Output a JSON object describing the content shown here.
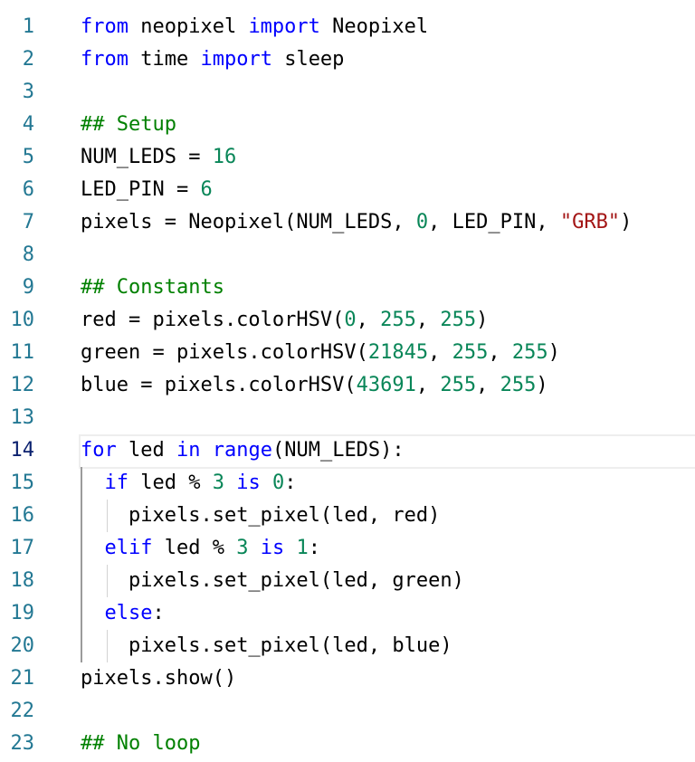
{
  "editor": {
    "active_line": 14,
    "colors": {
      "line_number": "#237893",
      "active_line_number": "#0b216f",
      "keyword": "#0000ff",
      "number": "#098658",
      "string": "#a31515",
      "comment": "#008000",
      "text": "#000000"
    },
    "lines": [
      {
        "n": "1",
        "indent": 0,
        "tokens": [
          [
            "kw",
            "from"
          ],
          [
            "t",
            " neopixel "
          ],
          [
            "kw",
            "import"
          ],
          [
            "t",
            " Neopixel"
          ]
        ]
      },
      {
        "n": "2",
        "indent": 0,
        "tokens": [
          [
            "kw",
            "from"
          ],
          [
            "t",
            " time "
          ],
          [
            "kw",
            "import"
          ],
          [
            "t",
            " sleep"
          ]
        ]
      },
      {
        "n": "3",
        "indent": 0,
        "tokens": []
      },
      {
        "n": "4",
        "indent": 0,
        "tokens": [
          [
            "com",
            "## Setup"
          ]
        ]
      },
      {
        "n": "5",
        "indent": 0,
        "tokens": [
          [
            "t",
            "NUM_LEDS = "
          ],
          [
            "num",
            "16"
          ]
        ]
      },
      {
        "n": "6",
        "indent": 0,
        "tokens": [
          [
            "t",
            "LED_PIN = "
          ],
          [
            "num",
            "6"
          ]
        ]
      },
      {
        "n": "7",
        "indent": 0,
        "tokens": [
          [
            "t",
            "pixels = Neopixel(NUM_LEDS, "
          ],
          [
            "num",
            "0"
          ],
          [
            "t",
            ", LED_PIN, "
          ],
          [
            "str",
            "\"GRB\""
          ],
          [
            "t",
            ")"
          ]
        ]
      },
      {
        "n": "8",
        "indent": 0,
        "tokens": []
      },
      {
        "n": "9",
        "indent": 0,
        "tokens": [
          [
            "com",
            "## Constants"
          ]
        ]
      },
      {
        "n": "10",
        "indent": 0,
        "tokens": [
          [
            "t",
            "red = pixels.colorHSV("
          ],
          [
            "num",
            "0"
          ],
          [
            "t",
            ", "
          ],
          [
            "num",
            "255"
          ],
          [
            "t",
            ", "
          ],
          [
            "num",
            "255"
          ],
          [
            "t",
            ")"
          ]
        ]
      },
      {
        "n": "11",
        "indent": 0,
        "tokens": [
          [
            "t",
            "green = pixels.colorHSV("
          ],
          [
            "num",
            "21845"
          ],
          [
            "t",
            ", "
          ],
          [
            "num",
            "255"
          ],
          [
            "t",
            ", "
          ],
          [
            "num",
            "255"
          ],
          [
            "t",
            ")"
          ]
        ]
      },
      {
        "n": "12",
        "indent": 0,
        "tokens": [
          [
            "t",
            "blue = pixels.colorHSV("
          ],
          [
            "num",
            "43691"
          ],
          [
            "t",
            ", "
          ],
          [
            "num",
            "255"
          ],
          [
            "t",
            ", "
          ],
          [
            "num",
            "255"
          ],
          [
            "t",
            ")"
          ]
        ]
      },
      {
        "n": "13",
        "indent": 0,
        "tokens": []
      },
      {
        "n": "14",
        "indent": 0,
        "tokens": [
          [
            "kw",
            "for"
          ],
          [
            "t",
            " led "
          ],
          [
            "kw",
            "in"
          ],
          [
            "t",
            " "
          ],
          [
            "kw",
            "range"
          ],
          [
            "t",
            "(NUM_LEDS):"
          ]
        ]
      },
      {
        "n": "15",
        "indent": 1,
        "tokens": [
          [
            "kw",
            "if"
          ],
          [
            "t",
            " led % "
          ],
          [
            "num",
            "3"
          ],
          [
            "t",
            " "
          ],
          [
            "kw",
            "is"
          ],
          [
            "t",
            " "
          ],
          [
            "num",
            "0"
          ],
          [
            "t",
            ":"
          ]
        ]
      },
      {
        "n": "16",
        "indent": 2,
        "tokens": [
          [
            "t",
            "pixels.set_pixel(led, red)"
          ]
        ]
      },
      {
        "n": "17",
        "indent": 1,
        "tokens": [
          [
            "kw",
            "elif"
          ],
          [
            "t",
            " led % "
          ],
          [
            "num",
            "3"
          ],
          [
            "t",
            " "
          ],
          [
            "kw",
            "is"
          ],
          [
            "t",
            " "
          ],
          [
            "num",
            "1"
          ],
          [
            "t",
            ":"
          ]
        ]
      },
      {
        "n": "18",
        "indent": 2,
        "tokens": [
          [
            "t",
            "pixels.set_pixel(led, green)"
          ]
        ]
      },
      {
        "n": "19",
        "indent": 1,
        "tokens": [
          [
            "kw",
            "else"
          ],
          [
            "t",
            ":"
          ]
        ]
      },
      {
        "n": "20",
        "indent": 2,
        "tokens": [
          [
            "t",
            "pixels.set_pixel(led, blue)"
          ]
        ]
      },
      {
        "n": "21",
        "indent": 0,
        "tokens": [
          [
            "t",
            "pixels.show()"
          ]
        ]
      },
      {
        "n": "22",
        "indent": 0,
        "tokens": []
      },
      {
        "n": "23",
        "indent": 0,
        "tokens": [
          [
            "com",
            "## No loop"
          ]
        ]
      }
    ]
  }
}
